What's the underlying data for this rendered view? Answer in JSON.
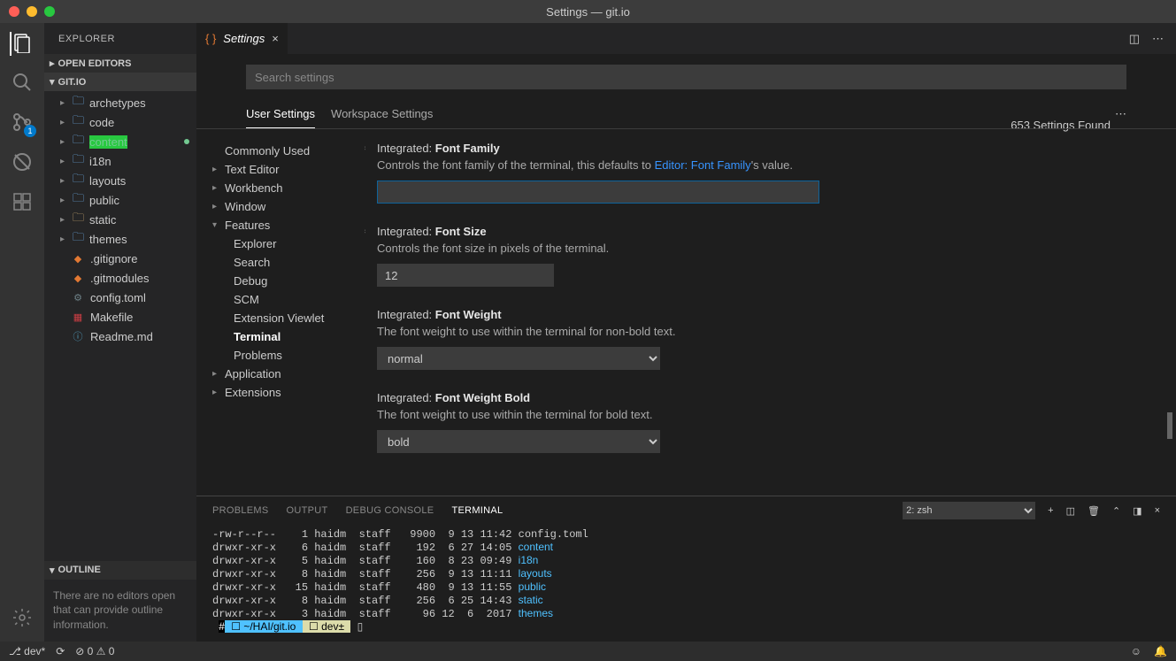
{
  "window": {
    "title": "Settings — git.io"
  },
  "sidebar": {
    "title": "EXPLORER",
    "sections": {
      "openEditors": "OPEN EDITORS",
      "workspace": "GIT.IO",
      "outline": "OUTLINE"
    },
    "tree": [
      {
        "label": "archetypes",
        "type": "folder"
      },
      {
        "label": "code",
        "type": "folder"
      },
      {
        "label": "content",
        "type": "folder",
        "green": true,
        "dot": true
      },
      {
        "label": "i18n",
        "type": "folder"
      },
      {
        "label": "layouts",
        "type": "folder"
      },
      {
        "label": "public",
        "type": "folder"
      },
      {
        "label": "static",
        "type": "folder",
        "yellow": true
      },
      {
        "label": "themes",
        "type": "folder"
      },
      {
        "label": ".gitignore",
        "type": "file",
        "icon": "◆",
        "color": "#e37933"
      },
      {
        "label": ".gitmodules",
        "type": "file",
        "icon": "◆",
        "color": "#e37933"
      },
      {
        "label": "config.toml",
        "type": "file",
        "icon": "⚙",
        "color": "#6d8086"
      },
      {
        "label": "Makefile",
        "type": "file",
        "icon": "▦",
        "color": "#cc3e44"
      },
      {
        "label": "Readme.md",
        "type": "file",
        "icon": "ⓘ",
        "color": "#519aba"
      }
    ],
    "outlineMsg": "There are no editors open that can provide outline information."
  },
  "tab": {
    "label": "Settings"
  },
  "search": {
    "placeholder": "Search settings",
    "found": "653 Settings Found"
  },
  "scopes": {
    "user": "User Settings",
    "workspace": "Workspace Settings"
  },
  "toc": {
    "commonly": "Commonly Used",
    "textEditor": "Text Editor",
    "workbench": "Workbench",
    "window": "Window",
    "features": "Features",
    "featuresItems": [
      "Explorer",
      "Search",
      "Debug",
      "SCM",
      "Extension Viewlet",
      "Terminal",
      "Problems"
    ],
    "application": "Application",
    "extensions": "Extensions"
  },
  "settings": {
    "fontFamily": {
      "prefix": "Integrated:",
      "title": "Font Family",
      "desc1": "Controls the font family of the terminal, this defaults to ",
      "link": "Editor: Font Family",
      "desc2": "'s value.",
      "value": ""
    },
    "fontSize": {
      "prefix": "Integrated:",
      "title": "Font Size",
      "desc": "Controls the font size in pixels of the terminal.",
      "value": "12"
    },
    "fontWeight": {
      "prefix": "Integrated:",
      "title": "Font Weight",
      "desc": "The font weight to use within the terminal for non-bold text.",
      "value": "normal"
    },
    "fontWeightBold": {
      "prefix": "Integrated:",
      "title": "Font Weight Bold",
      "desc": "The font weight to use within the terminal for bold text.",
      "value": "bold"
    }
  },
  "panel": {
    "tabs": {
      "problems": "PROBLEMS",
      "output": "OUTPUT",
      "debug": "DEBUG CONSOLE",
      "terminal": "TERMINAL"
    },
    "termSelect": "2: zsh",
    "lines": [
      {
        "p": "-rw-r--r--    1 haidm  staff   9900  9 13 11:42 ",
        "n": "config.toml",
        "d": false
      },
      {
        "p": "drwxr-xr-x    6 haidm  staff    192  6 27 14:05 ",
        "n": "content",
        "d": true
      },
      {
        "p": "drwxr-xr-x    5 haidm  staff    160  8 23 09:49 ",
        "n": "i18n",
        "d": true
      },
      {
        "p": "drwxr-xr-x    8 haidm  staff    256  9 13 11:11 ",
        "n": "layouts",
        "d": true
      },
      {
        "p": "drwxr-xr-x   15 haidm  staff    480  9 13 11:55 ",
        "n": "public",
        "d": true
      },
      {
        "p": "drwxr-xr-x    8 haidm  staff    256  6 25 14:43 ",
        "n": "static",
        "d": true
      },
      {
        "p": "drwxr-xr-x    3 haidm  staff     96 12  6  2017 ",
        "n": "themes",
        "d": true
      }
    ],
    "prompt": {
      "seg1": " ☐ ~/HAI/git.io ",
      "seg2": " ☐ dev± ",
      "cursor": "▯"
    }
  },
  "status": {
    "branch": "dev*",
    "errors": "0",
    "warnings": "0",
    "scmBadge": "1"
  }
}
